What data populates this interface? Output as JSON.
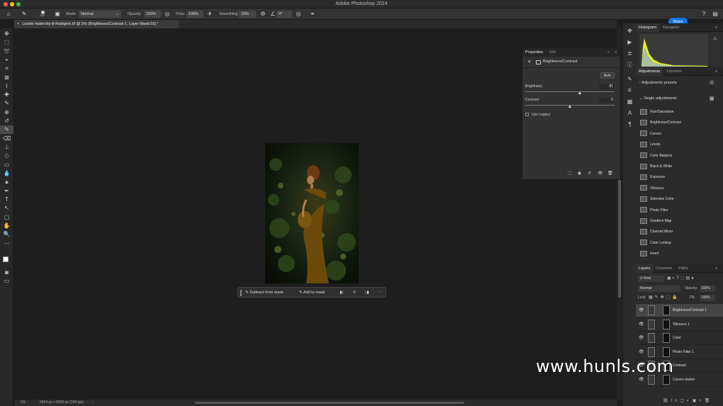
{
  "app": {
    "title": "Adobe Photoshop 2024"
  },
  "options_bar": {
    "brush_size": "812",
    "mode_label": "Mode:",
    "mode_value": "Normal",
    "opacity_label": "Opacity:",
    "opacity_value": "100%",
    "flow_label": "Flow:",
    "flow_value": "100%",
    "smoothing_label": "Smoothing:",
    "smoothing_value": "10%",
    "angle_value": "0°",
    "share_label": "Share"
  },
  "document": {
    "tab_title": "Lisette maternity-8-Radigers.tif @ 5% (Brightness/Contrast 1, Layer Mask/16) *"
  },
  "context_bar": {
    "subtract_label": "Subtract from mask",
    "add_label": "Add to mask"
  },
  "status_bar": {
    "zoom": "5%",
    "doc_info": "5824 px x 8256 px (240 ppi)"
  },
  "properties": {
    "tabs": [
      "Properties",
      "Info"
    ],
    "adjustment_name": "Brightness/Contrast",
    "auto_label": "Auto",
    "brightness_label": "Brightness:",
    "brightness_value": "81",
    "brightness_fraction": 0.61,
    "contrast_label": "Contrast:",
    "contrast_value": "0",
    "contrast_fraction": 0.5,
    "legacy_label": "Use Legacy"
  },
  "histogram": {
    "tabs": [
      "Histogram",
      "Navigator"
    ]
  },
  "adjustments": {
    "tabs": [
      "Adjustments",
      "Libraries"
    ],
    "presets_label": "Adjustments presets",
    "single_label": "Single adjustments",
    "items": [
      "Hue/Saturation",
      "Brightness/Contrast",
      "Curves",
      "Levels",
      "Color Balance",
      "Black & White",
      "Exposure",
      "Vibrance",
      "Selective Color",
      "Photo Filter",
      "Gradient Map",
      "Channel Mixer",
      "Color Lookup",
      "Invert"
    ]
  },
  "layers": {
    "tabs": [
      "Layers",
      "Channels",
      "Paths"
    ],
    "filter_kind": "Kind",
    "blend_mode": "Normal",
    "opacity_label": "Opacity:",
    "opacity_value": "100%",
    "lock_label": "Lock:",
    "fill_label": "Fill:",
    "fill_value": "100%",
    "items": [
      "Brightness/Contrast 1",
      "Vibrance 1",
      "Color",
      "Photo Filter 1",
      "Contrast",
      "Curves darker"
    ]
  },
  "watermark": "www.hunls.com",
  "colors": {
    "accent": "#1473e6",
    "bg": "#1e1e1e",
    "panel": "#323232"
  }
}
